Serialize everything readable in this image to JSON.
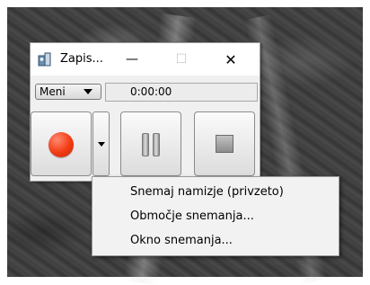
{
  "window": {
    "title": "Zapis...",
    "minimize_glyph": "—",
    "maximize_glyph": "☐",
    "close_glyph": "✕",
    "icon": "recorder-app-icon"
  },
  "toolbar": {
    "menu_label": "Meni",
    "timer": "0:00:00"
  },
  "buttons": {
    "record": "record-icon",
    "record_dropdown": "chevron-down-icon",
    "pause": "pause-icon",
    "stop": "stop-icon"
  },
  "context_menu": {
    "items": [
      {
        "label": "Snemaj namizje (privzeto)"
      },
      {
        "label": "Območje snemanja..."
      },
      {
        "label": "Okno snemanja..."
      }
    ]
  },
  "colors": {
    "record_red": "#f23a12",
    "window_bg": "#f0f0f0",
    "menu_bg": "#f2f2f2"
  }
}
